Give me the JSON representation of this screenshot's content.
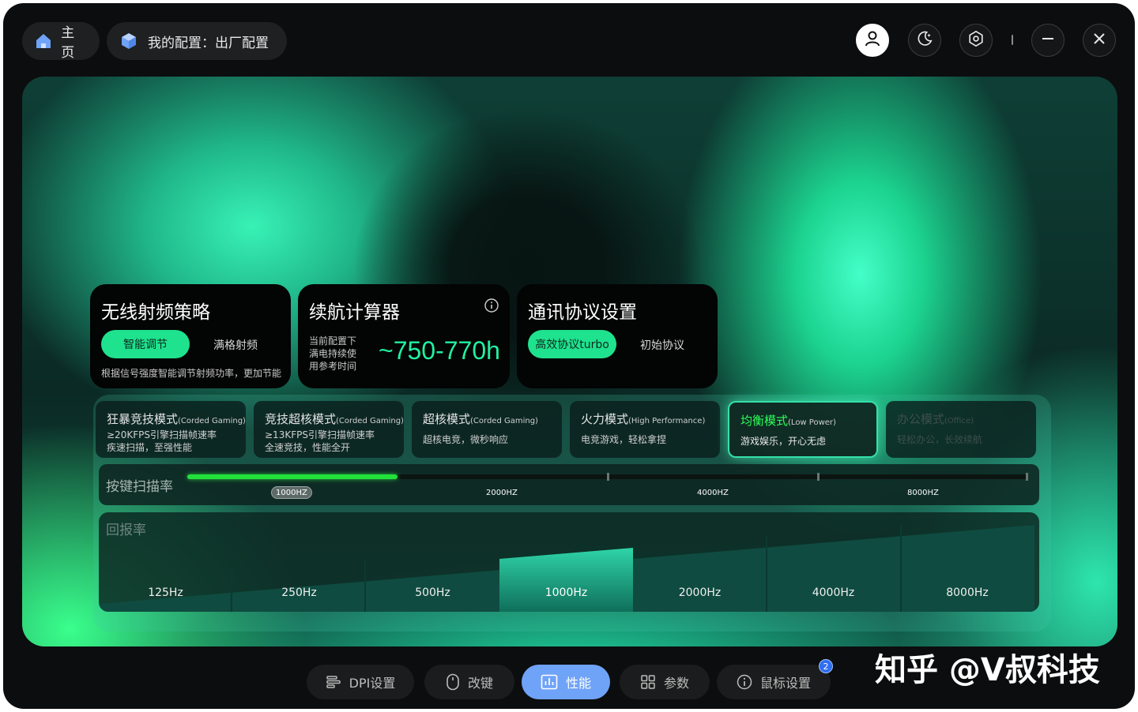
{
  "header": {
    "home_label": "主页",
    "config_label": "我的配置：出厂配置"
  },
  "cards": {
    "rf": {
      "title": "无线射频策略",
      "option_active": "智能调节",
      "option_other": "满格射频",
      "desc": "根据信号强度智能调节射频功率，更加节能"
    },
    "battery": {
      "title": "续航计算器",
      "note_lines": [
        "当前配置下",
        "满电持续使",
        "用参考时间"
      ],
      "value": "~750-770h"
    },
    "protocol": {
      "title": "通讯协议设置",
      "option_active": "高效协议turbo",
      "option_other": "初始协议"
    }
  },
  "modes": [
    {
      "name": "狂暴竞技模式",
      "sub": "(Corded Gaming)",
      "desc1": "≥20KFPS引擎扫描帧速率",
      "desc2": "疾速扫描，至强性能",
      "state": "normal"
    },
    {
      "name": "竞技超核模式",
      "sub": "(Corded Gaming)",
      "desc1": "≥13KFPS引擎扫描帧速率",
      "desc2": "全速竞技，性能全开",
      "state": "normal"
    },
    {
      "name": "超核模式",
      "sub": "(Corded Gaming)",
      "desc1": "超核电竞，微秒响应",
      "desc2": "",
      "state": "normal"
    },
    {
      "name": "火力模式",
      "sub": "(High Performance)",
      "desc1": "电竞游戏，轻松拿捏",
      "desc2": "",
      "state": "normal"
    },
    {
      "name": "均衡模式",
      "sub": "(Low Power)",
      "desc1": "游戏娱乐，开心无虑",
      "desc2": "",
      "state": "active"
    },
    {
      "name": "办公模式",
      "sub": "(Office)",
      "desc1": "轻松办公，长效续航",
      "desc2": "",
      "state": "dim"
    }
  ],
  "scan_rate": {
    "label": "按键扫描率",
    "ticks": [
      "1000HZ",
      "2000HZ",
      "4000HZ",
      "8000HZ"
    ],
    "selected": "1000HZ",
    "fill_fraction": 0.25,
    "fill_color": "#21e23a"
  },
  "report_rate": {
    "label": "回报率",
    "options": [
      "125Hz",
      "250Hz",
      "500Hz",
      "1000Hz",
      "2000Hz",
      "4000Hz",
      "8000Hz"
    ],
    "selected": "1000Hz"
  },
  "bottom_nav": [
    {
      "label": "DPI设置",
      "icon": "dpi-icon",
      "active": false
    },
    {
      "label": "改键",
      "icon": "mouse-icon",
      "active": false
    },
    {
      "label": "性能",
      "icon": "chart-icon",
      "active": true
    },
    {
      "label": "参数",
      "icon": "grid-icon",
      "active": false
    },
    {
      "label": "鼠标设置",
      "icon": "info-icon",
      "active": false,
      "badge": "2"
    }
  ],
  "watermark": "知乎 @V叔科技",
  "colors": {
    "accent_green": "#1fe28e",
    "nav_active": "#6fa3f7",
    "badge_blue": "#2f6ef0"
  }
}
